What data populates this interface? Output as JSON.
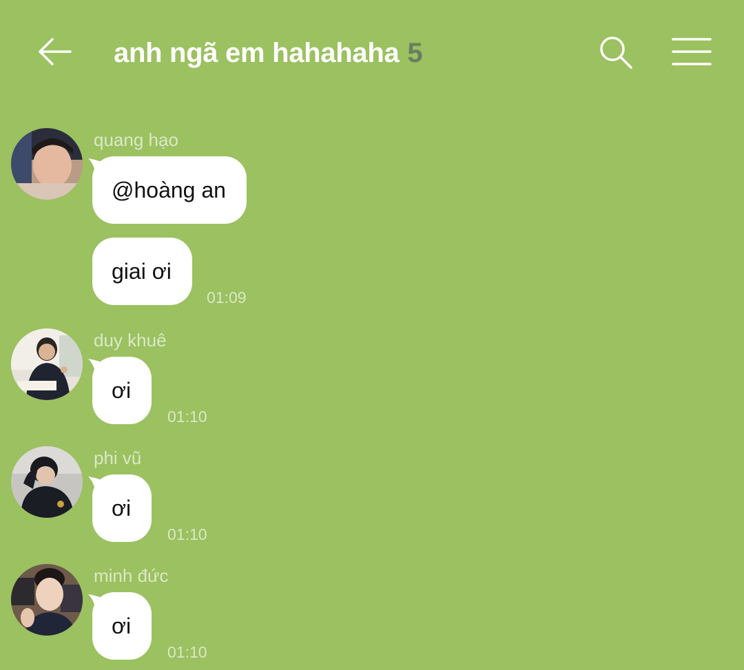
{
  "header": {
    "back_icon": "arrow-left-icon",
    "title": "anh ngã em hahahaha",
    "member_count": "5",
    "search_icon": "search-icon",
    "menu_icon": "hamburger-menu-icon"
  },
  "colors": {
    "background": "#9bc160",
    "bubble": "#ffffff",
    "muted_text": "#dbe8c6",
    "count": "#6a7d63"
  },
  "messages": [
    {
      "sender": "quang hạo",
      "avatar": "avatar-photo",
      "bubbles": [
        {
          "text": "@hoàng an"
        },
        {
          "text": "giai ơi",
          "time": "01:09"
        }
      ]
    },
    {
      "sender": "duy khuê",
      "avatar": "avatar-photo",
      "bubbles": [
        {
          "text": "ơi",
          "time": "01:10"
        }
      ]
    },
    {
      "sender": "phi vũ",
      "avatar": "avatar-photo",
      "bubbles": [
        {
          "text": "ơi",
          "time": "01:10"
        }
      ]
    },
    {
      "sender": "minh đức",
      "avatar": "avatar-photo",
      "bubbles": [
        {
          "text": "ơi",
          "time": "01:10"
        }
      ]
    }
  ]
}
